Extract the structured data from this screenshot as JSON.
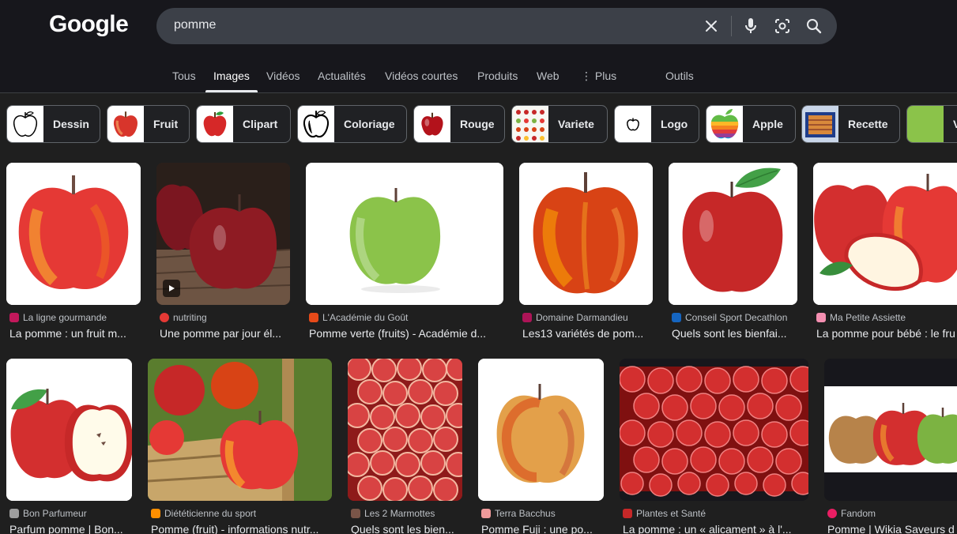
{
  "header": {
    "logo": "Google",
    "search_value": "pomme"
  },
  "tabs": [
    {
      "label": "Tous"
    },
    {
      "label": "Images"
    },
    {
      "label": "Vidéos"
    },
    {
      "label": "Actualités"
    },
    {
      "label": "Vidéos courtes"
    },
    {
      "label": "Produits"
    },
    {
      "label": "Web"
    },
    {
      "label": "Plus"
    },
    {
      "label": "Outils"
    }
  ],
  "active_tab": "Images",
  "chips": [
    {
      "label": "Dessin"
    },
    {
      "label": "Fruit"
    },
    {
      "label": "Clipart"
    },
    {
      "label": "Coloriage"
    },
    {
      "label": "Rouge"
    },
    {
      "label": "Variete"
    },
    {
      "label": "Logo"
    },
    {
      "label": "Apple"
    },
    {
      "label": "Recette"
    },
    {
      "label": "V"
    }
  ],
  "results_row1": [
    {
      "source": "La ligne gourmande",
      "title": "La pomme : un fruit m..."
    },
    {
      "source": "nutriting",
      "title": "Une pomme par jour él..."
    },
    {
      "source": "L'Académie du Goût",
      "title": "Pomme verte (fruits) - Académie d..."
    },
    {
      "source": "Domaine Darmandieu",
      "title": "Les13 variétés de pom..."
    },
    {
      "source": "Conseil Sport Decathlon",
      "title": "Quels sont les bienfai..."
    },
    {
      "source": "Ma Petite Assiette",
      "title": "La pomme pour bébé : le fru"
    }
  ],
  "results_row2": [
    {
      "source": "Bon Parfumeur",
      "title": "Parfum pomme | Bon..."
    },
    {
      "source": "Diététicienne du sport",
      "title": "Pomme (fruit) - informations nutr..."
    },
    {
      "source": "Les 2 Marmottes",
      "title": "Quels sont les bien..."
    },
    {
      "source": "Terra Bacchus",
      "title": "Pomme Fuji : une po..."
    },
    {
      "source": "Plantes et Santé",
      "title": "La pomme : un « alicament » à l'..."
    },
    {
      "source": "Fandom",
      "title": "Pomme | Wikia Saveurs d"
    }
  ],
  "colors": {
    "background": "#1f1f1f",
    "searchbar": "#3c4048",
    "text": "#e8eaed",
    "muted": "#bdc1c6"
  }
}
